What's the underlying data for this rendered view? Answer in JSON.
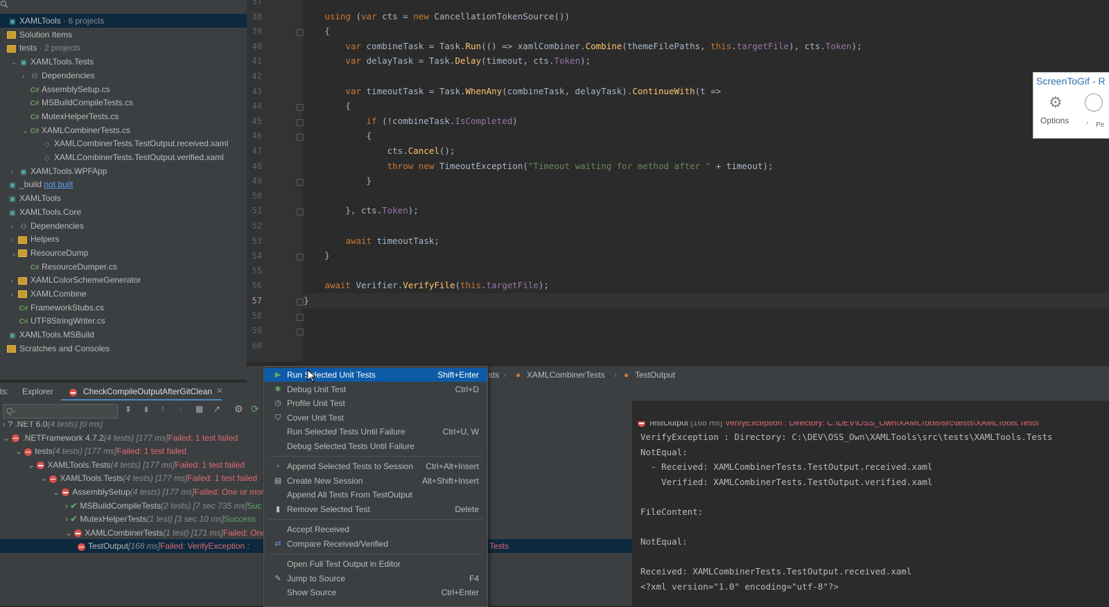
{
  "explorer": {
    "rows": [
      {
        "label": "XAMLTools",
        "extra": " · 6 projects",
        "icon": "solution"
      },
      {
        "label": "Solution Items",
        "icon": "folder"
      },
      {
        "label": "tests",
        "extra": " · 2 projects",
        "icon": "folder"
      },
      {
        "label": "XAMLTools.Tests",
        "icon": "project"
      },
      {
        "label": "Dependencies",
        "icon": "deps"
      },
      {
        "label": "AssemblySetup.cs",
        "icon": "cs"
      },
      {
        "label": "MSBuildCompileTests.cs",
        "icon": "cs"
      },
      {
        "label": "MutexHelperTests.cs",
        "icon": "cs"
      },
      {
        "label": "XAMLCombinerTests.cs",
        "icon": "cs"
      },
      {
        "label": "XAMLCombinerTests.TestOutput.received.xaml",
        "icon": "xaml"
      },
      {
        "label": "XAMLCombinerTests.TestOutput.verified.xaml",
        "icon": "xaml"
      },
      {
        "label": "XAMLTools.WPFApp",
        "icon": "project"
      },
      {
        "label": "_build",
        "extra": "not built",
        "icon": "project"
      },
      {
        "label": "XAMLTools",
        "icon": "project"
      },
      {
        "label": "XAMLTools.Core",
        "icon": "project"
      },
      {
        "label": "Dependencies",
        "icon": "deps"
      },
      {
        "label": "Helpers",
        "icon": "folder"
      },
      {
        "label": "ResourceDump",
        "icon": "folder"
      },
      {
        "label": "ResourceDumper.cs",
        "icon": "cs"
      },
      {
        "label": "XAMLColorSchemeGenerator",
        "icon": "folder"
      },
      {
        "label": "XAMLCombine",
        "icon": "folder"
      },
      {
        "label": "FrameworkStubs.cs",
        "icon": "cs"
      },
      {
        "label": "UTF8StringWriter.cs",
        "icon": "cs"
      },
      {
        "label": "XAMLTools.MSBuild",
        "icon": "project"
      },
      {
        "label": "Scratches and Consoles",
        "icon": "folder"
      }
    ]
  },
  "editor": {
    "line_numbers": [
      "37",
      "38",
      "39",
      "40",
      "41",
      "42",
      "43",
      "44",
      "45",
      "46",
      "47",
      "48",
      "49",
      "50",
      "51",
      "52",
      "53",
      "54",
      "55",
      "56",
      "57",
      "58",
      "59",
      "60"
    ],
    "current_line": "57",
    "lines": [
      "",
      "            using (var cts = new CancellationTokenSource())",
      "            {",
      "                var combineTask = Task.Run(() => xamlCombiner.Combine(themeFilePaths, this.targetFile), cts.Token);",
      "                var delayTask = Task.Delay(timeout, cts.Token);",
      "",
      "                var timeoutTask = Task.WhenAny(combineTask, delayTask).ContinueWith(t =>",
      "                {",
      "                    if (!combineTask.IsCompleted)",
      "                    {",
      "                        cts.Cancel();",
      "                        throw new TimeoutException(\"Timeout waiting for method after \" + timeout);",
      "                    }",
      "",
      "                }, cts.Token);",
      "",
      "                await timeoutTask;",
      "            }",
      "",
      "            await Verifier.VerifyFile(this.targetFile);",
      "        }",
      "    }",
      "}",
      ""
    ]
  },
  "breadcrumb": [
    "Tests",
    "XAMLCombinerTests",
    "TestOutput"
  ],
  "test_panel": {
    "label": "ts:",
    "tabs": [
      "Explorer",
      "CheckCompileOutputAfterGitClean"
    ],
    "search_placeholder": "Q-",
    "tree": [
      {
        "name": ".NET 6.0",
        "meta": "(4 tests) [0 ms]",
        "status": "",
        "state": "unknown"
      },
      {
        "name": ".NETFramework 4.7.2",
        "meta": "(4 tests) [177 ms]",
        "status": "Failed: 1 test failed",
        "state": "fail"
      },
      {
        "name": "tests",
        "meta": "(4 tests) [177 ms]",
        "status": "Failed: 1 test failed",
        "state": "fail"
      },
      {
        "name": "XAMLTools.Tests",
        "meta": "(4 tests) [177 ms]",
        "status": "Failed: 1 test failed",
        "state": "fail"
      },
      {
        "name": "XAMLTools.Tests",
        "meta": "(4 tests) [177 ms]",
        "status": "Failed: 1 test failed",
        "state": "fail"
      },
      {
        "name": "AssemblySetup",
        "meta": "(4 tests) [177 ms]",
        "status": "Failed: One or mor",
        "state": "fail"
      },
      {
        "name": "MSBuildCompileTests",
        "meta": "(2 tests) [7 sec 735 ms]",
        "status": "Suc",
        "state": "ok"
      },
      {
        "name": "MutexHelperTests",
        "meta": "(1 test) [3 sec 10 ms]",
        "status": "Success",
        "state": "ok"
      },
      {
        "name": "XAMLCombinerTests",
        "meta": "(1 test) [171 ms]",
        "status": "Failed: One",
        "state": "fail"
      },
      {
        "name": "TestOutput",
        "meta": "[168 ms]",
        "status": "Failed: VerifyException :",
        "state": "fail"
      }
    ],
    "selected_row_tail": "Tests"
  },
  "output": {
    "header_name": "TestOutput",
    "header_meta": "[168 ms]",
    "header_status": "VerifyException : Directory: C:\\DEV\\OSS_Own\\XAMLTools\\src\\tests\\XAMLTools.Tests",
    "lines": [
      "VerifyException : Directory: C:\\DEV\\OSS_Own\\XAMLTools\\src\\tests\\XAMLTools.Tests",
      "NotEqual:",
      "  - Received: XAMLCombinerTests.TestOutput.received.xaml",
      "    Verified: XAMLCombinerTests.TestOutput.verified.xaml",
      "",
      "FileContent:",
      "",
      "NotEqual:",
      "",
      "Received: XAMLCombinerTests.TestOutput.received.xaml",
      "<?xml version=\"1.0\" encoding=\"utf-8\"?>"
    ]
  },
  "context_menu": {
    "items": [
      {
        "label": "Run Selected Unit Tests",
        "shortcut": "Shift+Enter",
        "icon": "run",
        "highlight": true
      },
      {
        "label": "Debug Unit Test",
        "shortcut": "Ctrl+D",
        "icon": "debug"
      },
      {
        "label": "Profile Unit Test",
        "shortcut": "",
        "icon": "profile"
      },
      {
        "label": "Cover Unit Test",
        "shortcut": "",
        "icon": "cover"
      },
      {
        "label": "Run Selected Tests Until Failure",
        "shortcut": "Ctrl+U, W",
        "icon": ""
      },
      {
        "label": "Debug Selected Tests Until Failure",
        "shortcut": "",
        "icon": ""
      },
      {
        "sep": true
      },
      {
        "label": "Append Selected Tests to Session",
        "shortcut": "Ctrl+Alt+Insert",
        "icon": "plus"
      },
      {
        "label": "Create New Session",
        "shortcut": "Alt+Shift+Insert",
        "icon": "session"
      },
      {
        "label": "Append All Tests From TestOutput",
        "shortcut": "",
        "icon": ""
      },
      {
        "label": "Remove Selected Test",
        "shortcut": "Delete",
        "icon": "trash"
      },
      {
        "sep": true
      },
      {
        "label": "Accept Received",
        "shortcut": "",
        "icon": ""
      },
      {
        "label": "Compare Received/Verified",
        "shortcut": "",
        "icon": "compare"
      },
      {
        "sep": true
      },
      {
        "label": "Open Full Test Output in Editor",
        "shortcut": "",
        "icon": ""
      },
      {
        "label": "Jump to Source",
        "shortcut": "F4",
        "icon": "pencil"
      },
      {
        "label": "Show Source",
        "shortcut": "Ctrl+Enter",
        "icon": ""
      }
    ]
  },
  "screentogif": {
    "title": "ScreenToGif - R",
    "options_label": "Options",
    "pe_label": "Pe"
  },
  "colors": {
    "highlight": "#0d5aa7",
    "fail": "#e06c75",
    "success": "#5fa869",
    "keyword": "#cc7832",
    "method": "#ffc66d"
  }
}
